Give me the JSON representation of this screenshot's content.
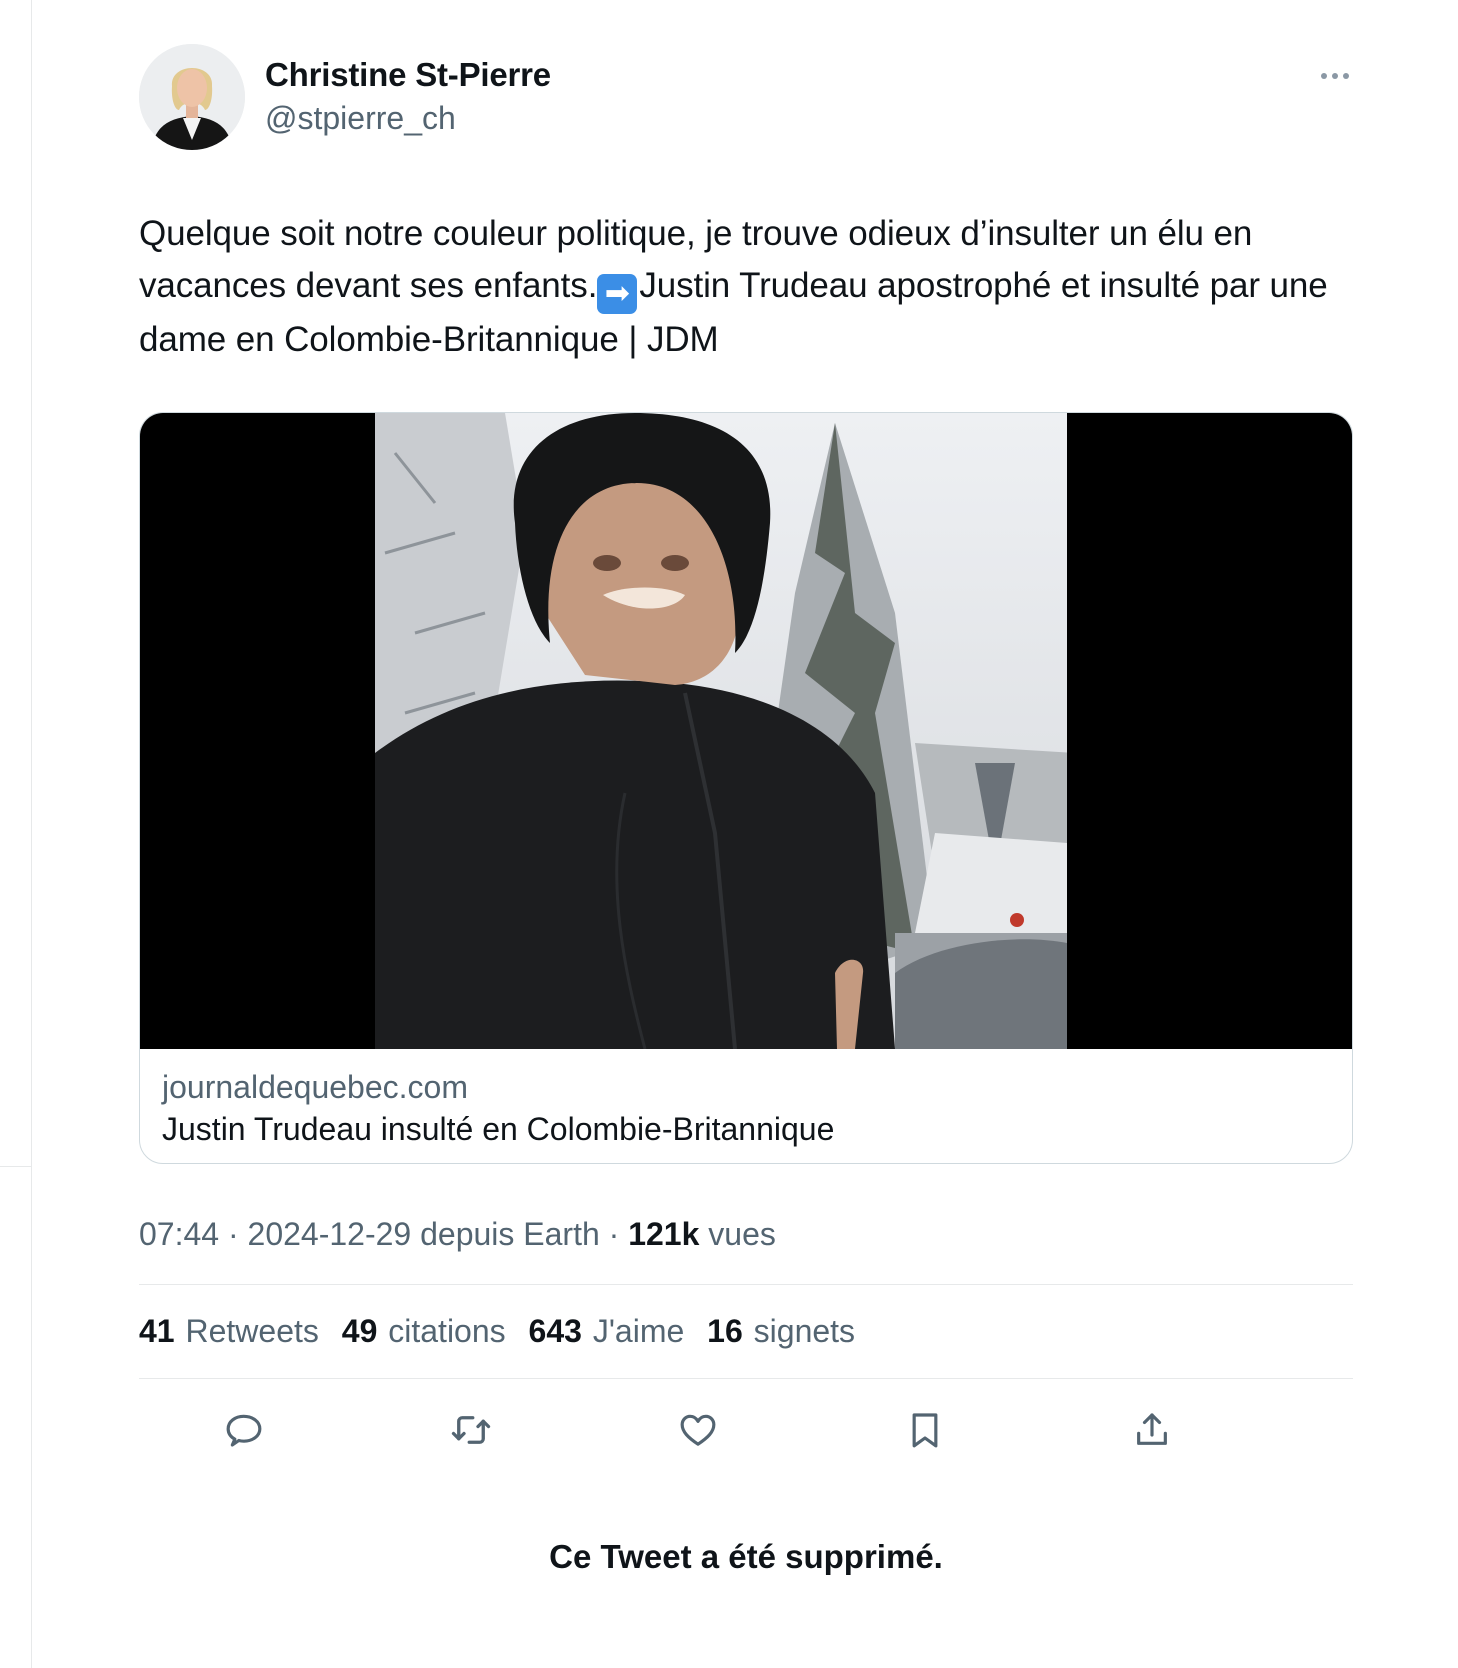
{
  "author": {
    "name": "Christine St-Pierre",
    "handle": "@stpierre_ch"
  },
  "tweet": {
    "text_part1": "Quelque soit notre couleur politique, je trouve odieux d’insulter un élu en vacances devant ses enfants.",
    "arrow_emoji": "➡",
    "text_part2": "Justin Trudeau apostrophé et insulté par une dame en Colombie-Britannique | JDM"
  },
  "card": {
    "domain": "journaldequebec.com",
    "title": "Justin Trudeau insulté en Colombie-Britannique"
  },
  "meta": {
    "time_date": "07:44 · 2024-12-29 depuis Earth · ",
    "views_count": "121k",
    "views_label": "vues"
  },
  "stats": [
    {
      "count": "41",
      "label": "Retweets"
    },
    {
      "count": "49",
      "label": "citations"
    },
    {
      "count": "643",
      "label": "J'aime"
    },
    {
      "count": "16",
      "label": "signets"
    }
  ],
  "actions": [
    {
      "icon": "reply-icon"
    },
    {
      "icon": "retweet-icon"
    },
    {
      "icon": "like-icon"
    },
    {
      "icon": "bookmark-icon"
    },
    {
      "icon": "share-icon"
    }
  ],
  "deleted_notice": "Ce Tweet a été supprimé.",
  "colors": {
    "text": "#0f1419",
    "secondary": "#536471",
    "border": "#cfd9de",
    "divider": "#e7e9ea"
  }
}
